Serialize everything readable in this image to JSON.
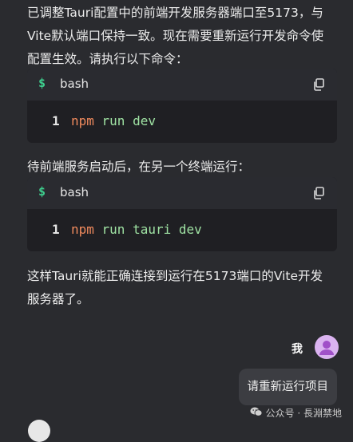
{
  "assistant_message": {
    "intro_lines": [
      "已调整Tauri配置中的前端开发服务器端口至5173，与",
      "Vite默认端口保持一致。现在需要重新运行开发命令使",
      "配置生效。请执行以下命令："
    ],
    "code_blocks": [
      {
        "prompt": "$",
        "language": "bash",
        "line_number": "1",
        "command": "npm",
        "args": " run dev"
      },
      {
        "prompt": "$",
        "language": "bash",
        "line_number": "1",
        "command": "npm",
        "args": " run tauri dev"
      }
    ],
    "middle_text": "待前端服务启动后，在另一个终端运行：",
    "outro_lines": [
      "这样Tauri就能正确连接到运行在5173端口的Vite开发",
      "服务器了。"
    ]
  },
  "user_message": {
    "name": "我",
    "text": "请重新运行项目"
  },
  "watermark": {
    "text": "公众号 · 長淵禁地"
  },
  "colors": {
    "background": "#2a2b2f",
    "code_background": "#1f1f23",
    "code_header": "#2a2b30",
    "prompt_green": "#3ecf8e",
    "command_orange": "#f08a5d",
    "args_green": "#9fe2a3",
    "avatar": "#dab3f0",
    "user_bubble": "#3c3d42"
  },
  "icons": {
    "copy": "copy-icon",
    "avatar": "user-avatar-icon",
    "wechat": "wechat-icon"
  }
}
